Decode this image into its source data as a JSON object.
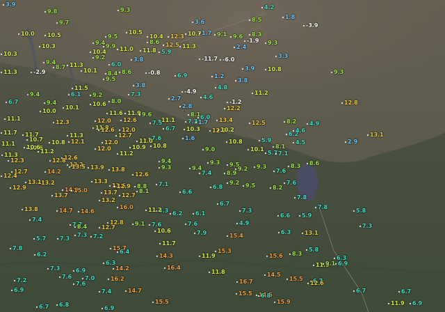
{
  "map": {
    "subject": "temperature station readings over Po Valley / Alps terrain",
    "palette": {
      "below_zero": "#ffffff",
      "0_4": "#6ec8ff",
      "4_8": "#3fe0c8",
      "8_10": "#9ee640",
      "10_12": "#d8ea4a",
      "12_14": "#f2c93c",
      "14_plus": "#f2a040"
    },
    "readings": [
      {
        "v": "3.9"
      },
      {
        "v": "9.8"
      },
      {
        "v": "9.3"
      },
      {
        "v": "3.6"
      },
      {
        "v": "8.5"
      },
      {
        "v": "4.2"
      },
      {
        "v": "1.8"
      },
      {
        "v": "-3.9"
      },
      {
        "v": "9.7"
      },
      {
        "v": "10.0"
      },
      {
        "v": "10.5"
      },
      {
        "v": "9.5"
      },
      {
        "v": "10.5"
      },
      {
        "v": "10.4"
      },
      {
        "v": "12.3"
      },
      {
        "v": "10.7"
      },
      {
        "v": "1.7"
      },
      {
        "v": "9.1"
      },
      {
        "v": "9.6"
      },
      {
        "v": "8.3"
      },
      {
        "v": "10.3"
      },
      {
        "v": "9.9"
      },
      {
        "v": "9.4"
      },
      {
        "v": "11.0"
      },
      {
        "v": "8.6"
      },
      {
        "v": "12.5"
      },
      {
        "v": "11.3"
      },
      {
        "v": "-1.9"
      },
      {
        "v": "9.3"
      },
      {
        "v": "10.3"
      },
      {
        "v": "10.4"
      },
      {
        "v": "11.8"
      },
      {
        "v": "5.9"
      },
      {
        "v": "2.4"
      },
      {
        "v": "9.4"
      },
      {
        "v": "9.2"
      },
      {
        "v": "3.8"
      },
      {
        "v": "-11.7"
      },
      {
        "v": "-6.0"
      },
      {
        "v": "3.3"
      },
      {
        "v": "11.3"
      },
      {
        "v": "8.7"
      },
      {
        "v": "11.3"
      },
      {
        "v": "6.0"
      },
      {
        "v": "10.1"
      },
      {
        "v": "8.4"
      },
      {
        "v": "-0.8"
      },
      {
        "v": "6.9"
      },
      {
        "v": "3.9"
      },
      {
        "v": "10.8"
      },
      {
        "v": "9.3"
      },
      {
        "v": "-2.9"
      },
      {
        "v": "9.5"
      },
      {
        "v": "8.6"
      },
      {
        "v": "1.2"
      },
      {
        "v": "3.8"
      },
      {
        "v": "11.5"
      },
      {
        "v": "3.8"
      },
      {
        "v": "4.8"
      },
      {
        "v": "-4.9"
      },
      {
        "v": "9.4"
      },
      {
        "v": "6.1"
      },
      {
        "v": "9.2"
      },
      {
        "v": "7.3"
      },
      {
        "v": "2.7"
      },
      {
        "v": "4.6"
      },
      {
        "v": "11.2"
      },
      {
        "v": "8.0"
      },
      {
        "v": "6.7"
      },
      {
        "v": "9.4"
      },
      {
        "v": "10.6"
      },
      {
        "v": "2.8"
      },
      {
        "v": "-1.2"
      },
      {
        "v": "12.8"
      },
      {
        "v": "12.2"
      },
      {
        "v": "10.0"
      },
      {
        "v": "10.1"
      },
      {
        "v": "11.6"
      },
      {
        "v": "11.9"
      },
      {
        "v": "9.6"
      },
      {
        "v": "8.1"
      },
      {
        "v": "11.1"
      },
      {
        "v": "12.0"
      },
      {
        "v": "12.6"
      },
      {
        "v": "11.1"
      },
      {
        "v": "7.3"
      },
      {
        "v": "1.7"
      },
      {
        "v": "6.0"
      },
      {
        "v": "10.3"
      },
      {
        "v": "12.5"
      },
      {
        "v": "11.7"
      },
      {
        "v": "11.7"
      },
      {
        "v": "11.3"
      },
      {
        "v": "11.8"
      },
      {
        "v": "12.0"
      },
      {
        "v": "7.5"
      },
      {
        "v": "6.7"
      },
      {
        "v": "12.8"
      },
      {
        "v": "13.4"
      },
      {
        "v": "8.2"
      },
      {
        "v": "4.9"
      },
      {
        "v": "13.1"
      },
      {
        "v": "10.7"
      },
      {
        "v": "12.1"
      },
      {
        "v": "12.6"
      },
      {
        "v": "12.7"
      },
      {
        "v": "12.3"
      },
      {
        "v": "7.6"
      },
      {
        "v": "10.2"
      },
      {
        "v": "6.2"
      },
      {
        "v": "4.6"
      },
      {
        "v": "11.1"
      },
      {
        "v": "10.8"
      },
      {
        "v": "12.0"
      },
      {
        "v": "10.6"
      },
      {
        "v": "11.0"
      },
      {
        "v": "1.6"
      },
      {
        "v": "5.9"
      },
      {
        "v": "4.5"
      },
      {
        "v": "2.9"
      },
      {
        "v": "10.6"
      },
      {
        "v": "11.2"
      },
      {
        "v": "10.9"
      },
      {
        "v": "10.8"
      },
      {
        "v": "9.0"
      },
      {
        "v": "10.8"
      },
      {
        "v": "10.1"
      },
      {
        "v": "8.1"
      },
      {
        "v": "11.3"
      },
      {
        "v": "12.6"
      },
      {
        "v": "12.0"
      },
      {
        "v": "11.2"
      },
      {
        "v": "5.7"
      },
      {
        "v": "7.1"
      },
      {
        "v": "12.3"
      },
      {
        "v": "12.8"
      },
      {
        "v": "12.2"
      },
      {
        "v": "9.4"
      },
      {
        "v": "9.3"
      },
      {
        "v": "8.6"
      },
      {
        "v": "12.7"
      },
      {
        "v": "13.5"
      },
      {
        "v": "13.9"
      },
      {
        "v": "13.8"
      },
      {
        "v": "9.3"
      },
      {
        "v": "9.4"
      },
      {
        "v": "9.5"
      },
      {
        "v": "9.2"
      },
      {
        "v": "7.6"
      },
      {
        "v": "8.3"
      },
      {
        "v": "12.4"
      },
      {
        "v": "14.2"
      },
      {
        "v": "12.6"
      },
      {
        "v": "7.4"
      },
      {
        "v": "8.9"
      },
      {
        "v": "9.3"
      },
      {
        "v": "12.9"
      },
      {
        "v": "13.2"
      },
      {
        "v": "13.3"
      },
      {
        "v": "13.6"
      },
      {
        "v": "12.9"
      },
      {
        "v": "8.8"
      },
      {
        "v": "7.1"
      },
      {
        "v": "6.8"
      },
      {
        "v": "9.2"
      },
      {
        "v": "9.5"
      },
      {
        "v": "8.2"
      },
      {
        "v": "7.6"
      },
      {
        "v": "13.1"
      },
      {
        "v": "14.9"
      },
      {
        "v": "15.0"
      },
      {
        "v": "13.7"
      },
      {
        "v": "8.1"
      },
      {
        "v": "6.6"
      },
      {
        "v": "7.8"
      },
      {
        "v": "13.8"
      },
      {
        "v": "13.7"
      },
      {
        "v": "13.2"
      },
      {
        "v": "12.7"
      },
      {
        "v": "6.3"
      },
      {
        "v": "6.7"
      },
      {
        "v": "7.3"
      },
      {
        "v": "7.8"
      },
      {
        "v": "7.4"
      },
      {
        "v": "14.7"
      },
      {
        "v": "14.6"
      },
      {
        "v": "16.0"
      },
      {
        "v": "11.2"
      },
      {
        "v": "6.2"
      },
      {
        "v": "6.1"
      },
      {
        "v": "5.8"
      },
      {
        "v": "7.7"
      },
      {
        "v": "12.8"
      },
      {
        "v": "9.1"
      },
      {
        "v": "7.6"
      },
      {
        "v": "7.6"
      },
      {
        "v": "4.9"
      },
      {
        "v": "6.6"
      },
      {
        "v": "7.3"
      },
      {
        "v": "8.4"
      },
      {
        "v": "12.7"
      },
      {
        "v": "10.6"
      },
      {
        "v": "7.9"
      },
      {
        "v": "5.9"
      },
      {
        "v": "7.3"
      },
      {
        "v": "7.2"
      },
      {
        "v": "11.7"
      },
      {
        "v": "15.4"
      },
      {
        "v": "6.3"
      },
      {
        "v": "5.7"
      },
      {
        "v": "7.3"
      },
      {
        "v": "15.7"
      },
      {
        "v": "15.3"
      },
      {
        "v": "13.1"
      },
      {
        "v": "5.8"
      },
      {
        "v": "7.8"
      },
      {
        "v": "6.4"
      },
      {
        "v": "14.3"
      },
      {
        "v": "11.9"
      },
      {
        "v": "8.3"
      },
      {
        "v": "6.3"
      },
      {
        "v": "6.2"
      },
      {
        "v": "6.3"
      },
      {
        "v": "15.6"
      },
      {
        "v": "11.9"
      },
      {
        "v": "6.9"
      },
      {
        "v": "7.3"
      },
      {
        "v": "6.9"
      },
      {
        "v": "14.2"
      },
      {
        "v": "16.4"
      },
      {
        "v": "11.8"
      },
      {
        "v": "9.1"
      },
      {
        "v": "7.6"
      },
      {
        "v": "7.0"
      },
      {
        "v": "16.2"
      },
      {
        "v": "14.5"
      },
      {
        "v": "15.5"
      },
      {
        "v": "6.7"
      },
      {
        "v": "7.2"
      },
      {
        "v": "7.6"
      },
      {
        "v": "14.7"
      },
      {
        "v": "16.7"
      },
      {
        "v": "12.6"
      },
      {
        "v": "6.7"
      },
      {
        "v": "6.9"
      },
      {
        "v": "7.4"
      },
      {
        "v": "15.5"
      },
      {
        "v": "14.5"
      },
      {
        "v": "6.7"
      },
      {
        "v": "6.7"
      },
      {
        "v": "6.8"
      },
      {
        "v": "15.5"
      },
      {
        "v": "15.9"
      },
      {
        "v": "11.9"
      },
      {
        "v": "6.9"
      },
      {
        "v": "6.9"
      },
      {
        "v": "6.8"
      },
      {
        "v": "13.8"
      },
      {
        "v": "5.8"
      }
    ]
  }
}
